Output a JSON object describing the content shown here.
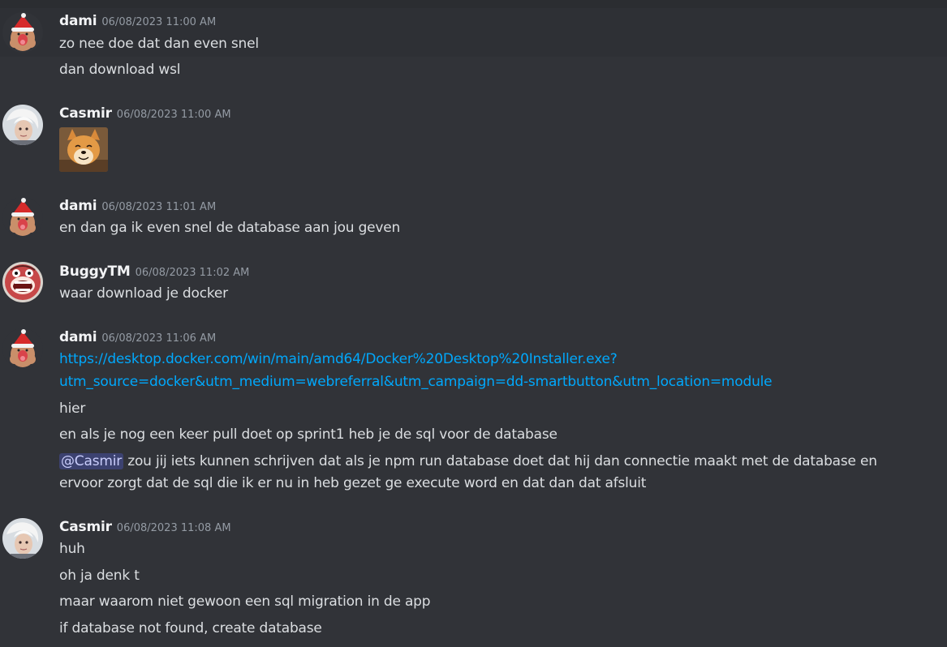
{
  "messages": [
    {
      "author": "dami",
      "timestamp": "06/08/2023 11:00 AM",
      "lines": [
        "zo nee doe dat dan even snel",
        "dan download wsl"
      ]
    },
    {
      "author": "Casmir",
      "timestamp": "06/08/2023 11:00 AM",
      "sticker": "shiba-doge-sticker"
    },
    {
      "author": "dami",
      "timestamp": "06/08/2023 11:01 AM",
      "lines": [
        "en dan ga ik even snel de database aan jou geven"
      ]
    },
    {
      "author": "BuggyTM",
      "timestamp": "06/08/2023 11:02 AM",
      "lines": [
        "waar download je docker"
      ]
    },
    {
      "author": "dami",
      "timestamp": "06/08/2023 11:06 AM",
      "link_line1": "https://desktop.docker.com/win/main/amd64/Docker%20Desktop%20Installer.exe?",
      "link_line2": "utm_source=docker&utm_medium=webreferral&utm_campaign=dd-smartbutton&utm_location=module",
      "lines": [
        "hier",
        "en als je nog een keer pull doet op sprint1 heb je de sql voor de database"
      ],
      "mention": "@Casmir",
      "mention_text_1": " zou jij iets kunnen schrijven dat als je  npm run database doet dat hij dan connectie maakt met de database en",
      "mention_text_2": "ervoor zorgt dat de sql die ik er nu in heb gezet ge execute word en dat dan dat afsluit"
    },
    {
      "author": "Casmir",
      "timestamp": "06/08/2023 11:08 AM",
      "lines": [
        "huh",
        "oh ja denk t",
        "maar waarom niet gewoon een sql migration in de app",
        "if database not found, create database"
      ]
    }
  ],
  "colors": {
    "background": "#313338",
    "link": "#00a8fc",
    "mention_bg": "#3c4270",
    "author": "#f2f3f5",
    "timestamp": "#949ba4"
  }
}
